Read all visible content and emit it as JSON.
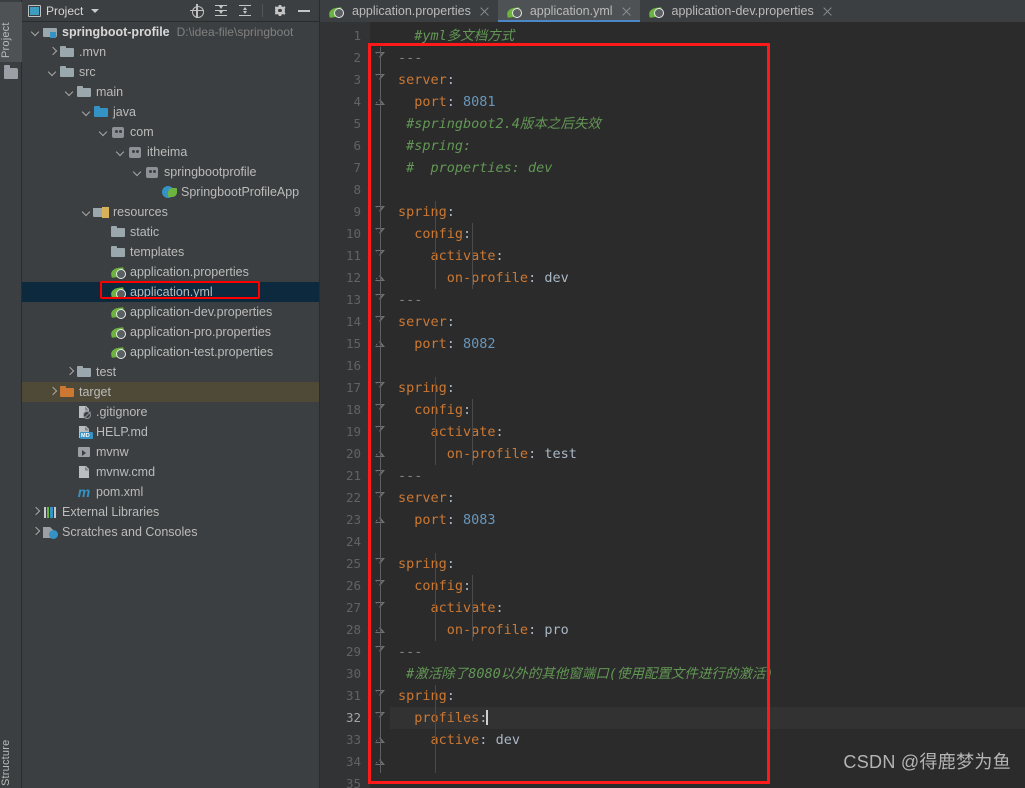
{
  "toolwindow_bars": {
    "left_top": "Project",
    "left_bottom": "Structure"
  },
  "panel": {
    "title": "Project",
    "title_icon": "project-window-icon",
    "actions": [
      {
        "name": "locate-icon",
        "label": "Select Opened File"
      },
      {
        "name": "expand-all-icon",
        "label": "Expand All"
      },
      {
        "name": "collapse-all-icon",
        "label": "Collapse All"
      },
      {
        "name": "gear-icon",
        "label": "Settings"
      },
      {
        "name": "minimize-icon",
        "label": "Hide"
      }
    ]
  },
  "tree": [
    {
      "label": "springboot-profile",
      "path": "D:\\idea-file\\springboot",
      "icon": "module-folder-icon",
      "arrow": "down",
      "depth": 0,
      "bold": true
    },
    {
      "label": ".mvn",
      "icon": "folder-icon",
      "arrow": "right",
      "depth": 1,
      "bold": false
    },
    {
      "label": "src",
      "icon": "folder-icon",
      "arrow": "down",
      "depth": 1,
      "bold": false
    },
    {
      "label": "main",
      "icon": "folder-icon",
      "arrow": "down",
      "depth": 2,
      "bold": false
    },
    {
      "label": "java",
      "icon": "source-folder-icon",
      "arrow": "down",
      "depth": 3,
      "bold": false
    },
    {
      "label": "com",
      "icon": "package-icon",
      "arrow": "down",
      "depth": 4,
      "bold": false
    },
    {
      "label": "itheima",
      "icon": "package-icon",
      "arrow": "down",
      "depth": 5,
      "bold": false
    },
    {
      "label": "springbootprofile",
      "icon": "package-icon",
      "arrow": "down",
      "depth": 6,
      "bold": false
    },
    {
      "label": "SpringbootProfileApp",
      "icon": "spring-application-class-icon",
      "arrow": "none",
      "depth": 7,
      "bold": false
    },
    {
      "label": "resources",
      "icon": "resources-folder-icon",
      "arrow": "down",
      "depth": 3,
      "bold": false
    },
    {
      "label": "static",
      "icon": "folder-icon",
      "arrow": "none",
      "depth": 4,
      "bold": false
    },
    {
      "label": "templates",
      "icon": "folder-icon",
      "arrow": "none",
      "depth": 4,
      "bold": false
    },
    {
      "label": "application.properties",
      "icon": "spring-config-icon",
      "arrow": "none",
      "depth": 4,
      "bold": false
    },
    {
      "label": "application.yml",
      "icon": "spring-config-icon",
      "arrow": "none",
      "depth": 4,
      "bold": false,
      "selected": "blue",
      "annotated": true
    },
    {
      "label": "application-dev.properties",
      "icon": "spring-config-icon",
      "arrow": "none",
      "depth": 4,
      "bold": false
    },
    {
      "label": "application-pro.properties",
      "icon": "spring-config-icon",
      "arrow": "none",
      "depth": 4,
      "bold": false
    },
    {
      "label": "application-test.properties",
      "icon": "spring-config-icon",
      "arrow": "none",
      "depth": 4,
      "bold": false
    },
    {
      "label": "test",
      "icon": "folder-icon",
      "arrow": "right",
      "depth": 2,
      "bold": false
    },
    {
      "label": "target",
      "icon": "target-folder-icon",
      "arrow": "right",
      "depth": 1,
      "bold": false,
      "selected": "brown"
    },
    {
      "label": ".gitignore",
      "icon": "gitignore-file-icon",
      "arrow": "none",
      "depth": 2,
      "bold": false
    },
    {
      "label": "HELP.md",
      "icon": "markdown-file-icon",
      "arrow": "none",
      "depth": 2,
      "bold": false
    },
    {
      "label": "mvnw",
      "icon": "shell-script-icon",
      "arrow": "none",
      "depth": 2,
      "bold": false
    },
    {
      "label": "mvnw.cmd",
      "icon": "text-file-icon",
      "arrow": "none",
      "depth": 2,
      "bold": false
    },
    {
      "label": "pom.xml",
      "icon": "maven-pom-icon",
      "arrow": "none",
      "depth": 2,
      "bold": false
    },
    {
      "label": "External Libraries",
      "icon": "external-libraries-icon",
      "arrow": "right",
      "depth": 0,
      "bold": false
    },
    {
      "label": "Scratches and Consoles",
      "icon": "scratches-icon",
      "arrow": "right",
      "depth": 0,
      "bold": false
    }
  ],
  "tabs": [
    {
      "label": "application.properties",
      "icon": "spring-config-icon",
      "active": false
    },
    {
      "label": "application.yml",
      "icon": "spring-config-icon",
      "active": true
    },
    {
      "label": "application-dev.properties",
      "icon": "spring-config-icon",
      "active": false
    }
  ],
  "editor": {
    "current_line": 32,
    "total_lines_shown": 35,
    "lines": [
      {
        "n": 1,
        "fold": "none",
        "tokens": [
          {
            "t": "  ",
            "c": "t-punc"
          },
          {
            "t": "#yml多文档方式",
            "c": "t-comment"
          }
        ]
      },
      {
        "n": 2,
        "fold": "tri",
        "tokens": [
          {
            "t": "---",
            "c": "t-sep"
          }
        ]
      },
      {
        "n": 3,
        "fold": "tri",
        "tokens": [
          {
            "t": "server",
            "c": "t-key"
          },
          {
            "t": ":",
            "c": "t-punc"
          }
        ]
      },
      {
        "n": 4,
        "fold": "end",
        "tokens": [
          {
            "t": "  ",
            "c": "t-punc"
          },
          {
            "t": "port",
            "c": "t-key"
          },
          {
            "t": ": ",
            "c": "t-punc"
          },
          {
            "t": "8081",
            "c": "t-num"
          }
        ]
      },
      {
        "n": 5,
        "fold": "none",
        "tokens": [
          {
            "t": " ",
            "c": "t-punc"
          },
          {
            "t": "#springboot2.4版本之后失效",
            "c": "t-comment"
          }
        ]
      },
      {
        "n": 6,
        "fold": "none",
        "tokens": [
          {
            "t": " ",
            "c": "t-punc"
          },
          {
            "t": "#spring:",
            "c": "t-comment"
          }
        ]
      },
      {
        "n": 7,
        "fold": "none",
        "tokens": [
          {
            "t": " ",
            "c": "t-punc"
          },
          {
            "t": "#  properties: dev",
            "c": "t-comment"
          }
        ]
      },
      {
        "n": 8,
        "fold": "none",
        "tokens": []
      },
      {
        "n": 9,
        "fold": "tri",
        "tokens": [
          {
            "t": "spring",
            "c": "t-key"
          },
          {
            "t": ":",
            "c": "t-punc"
          }
        ]
      },
      {
        "n": 10,
        "fold": "tri",
        "tokens": [
          {
            "t": "  ",
            "c": "t-punc"
          },
          {
            "t": "config",
            "c": "t-key"
          },
          {
            "t": ":",
            "c": "t-punc"
          }
        ]
      },
      {
        "n": 11,
        "fold": "tri",
        "tokens": [
          {
            "t": "    ",
            "c": "t-punc"
          },
          {
            "t": "activate",
            "c": "t-key"
          },
          {
            "t": ":",
            "c": "t-punc"
          }
        ]
      },
      {
        "n": 12,
        "fold": "end",
        "tokens": [
          {
            "t": "      ",
            "c": "t-punc"
          },
          {
            "t": "on-profile",
            "c": "t-key"
          },
          {
            "t": ": ",
            "c": "t-punc"
          },
          {
            "t": "dev",
            "c": "t-str"
          }
        ]
      },
      {
        "n": 13,
        "fold": "tri",
        "tokens": [
          {
            "t": "---",
            "c": "t-sep"
          }
        ]
      },
      {
        "n": 14,
        "fold": "tri",
        "tokens": [
          {
            "t": "server",
            "c": "t-key"
          },
          {
            "t": ":",
            "c": "t-punc"
          }
        ]
      },
      {
        "n": 15,
        "fold": "end",
        "tokens": [
          {
            "t": "  ",
            "c": "t-punc"
          },
          {
            "t": "port",
            "c": "t-key"
          },
          {
            "t": ": ",
            "c": "t-punc"
          },
          {
            "t": "8082",
            "c": "t-num"
          }
        ]
      },
      {
        "n": 16,
        "fold": "none",
        "tokens": []
      },
      {
        "n": 17,
        "fold": "tri",
        "tokens": [
          {
            "t": "spring",
            "c": "t-key"
          },
          {
            "t": ":",
            "c": "t-punc"
          }
        ]
      },
      {
        "n": 18,
        "fold": "tri",
        "tokens": [
          {
            "t": "  ",
            "c": "t-punc"
          },
          {
            "t": "config",
            "c": "t-key"
          },
          {
            "t": ":",
            "c": "t-punc"
          }
        ]
      },
      {
        "n": 19,
        "fold": "tri",
        "tokens": [
          {
            "t": "    ",
            "c": "t-punc"
          },
          {
            "t": "activate",
            "c": "t-key"
          },
          {
            "t": ":",
            "c": "t-punc"
          }
        ]
      },
      {
        "n": 20,
        "fold": "end",
        "tokens": [
          {
            "t": "      ",
            "c": "t-punc"
          },
          {
            "t": "on-profile",
            "c": "t-key"
          },
          {
            "t": ": ",
            "c": "t-punc"
          },
          {
            "t": "test",
            "c": "t-str"
          }
        ]
      },
      {
        "n": 21,
        "fold": "tri",
        "tokens": [
          {
            "t": "---",
            "c": "t-sep"
          }
        ]
      },
      {
        "n": 22,
        "fold": "tri",
        "tokens": [
          {
            "t": "server",
            "c": "t-key"
          },
          {
            "t": ":",
            "c": "t-punc"
          }
        ]
      },
      {
        "n": 23,
        "fold": "end",
        "tokens": [
          {
            "t": "  ",
            "c": "t-punc"
          },
          {
            "t": "port",
            "c": "t-key"
          },
          {
            "t": ": ",
            "c": "t-punc"
          },
          {
            "t": "8083",
            "c": "t-num"
          }
        ]
      },
      {
        "n": 24,
        "fold": "none",
        "tokens": []
      },
      {
        "n": 25,
        "fold": "tri",
        "tokens": [
          {
            "t": "spring",
            "c": "t-key"
          },
          {
            "t": ":",
            "c": "t-punc"
          }
        ]
      },
      {
        "n": 26,
        "fold": "tri",
        "tokens": [
          {
            "t": "  ",
            "c": "t-punc"
          },
          {
            "t": "config",
            "c": "t-key"
          },
          {
            "t": ":",
            "c": "t-punc"
          }
        ]
      },
      {
        "n": 27,
        "fold": "tri",
        "tokens": [
          {
            "t": "    ",
            "c": "t-punc"
          },
          {
            "t": "activate",
            "c": "t-key"
          },
          {
            "t": ":",
            "c": "t-punc"
          }
        ]
      },
      {
        "n": 28,
        "fold": "end",
        "tokens": [
          {
            "t": "      ",
            "c": "t-punc"
          },
          {
            "t": "on-profile",
            "c": "t-key"
          },
          {
            "t": ": ",
            "c": "t-punc"
          },
          {
            "t": "pro",
            "c": "t-str"
          }
        ]
      },
      {
        "n": 29,
        "fold": "tri",
        "tokens": [
          {
            "t": "---",
            "c": "t-sep"
          }
        ]
      },
      {
        "n": 30,
        "fold": "none",
        "tokens": [
          {
            "t": " ",
            "c": "t-punc"
          },
          {
            "t": "#激活除了8080以外的其他窗端口(使用配置文件进行的激活)",
            "c": "t-comment"
          }
        ]
      },
      {
        "n": 31,
        "fold": "tri",
        "tokens": [
          {
            "t": "spring",
            "c": "t-key"
          },
          {
            "t": ":",
            "c": "t-punc"
          }
        ]
      },
      {
        "n": 32,
        "fold": "tri",
        "current": true,
        "caret_after": true,
        "tokens": [
          {
            "t": "  ",
            "c": "t-punc"
          },
          {
            "t": "profiles",
            "c": "t-key"
          },
          {
            "t": ":",
            "c": "t-punc"
          }
        ]
      },
      {
        "n": 33,
        "fold": "end",
        "tokens": [
          {
            "t": "    ",
            "c": "t-punc"
          },
          {
            "t": "active",
            "c": "t-key"
          },
          {
            "t": ": ",
            "c": "t-punc"
          },
          {
            "t": "dev",
            "c": "t-str"
          }
        ]
      },
      {
        "n": 34,
        "fold": "end",
        "tokens": []
      },
      {
        "n": 35,
        "fold": "none",
        "tokens": []
      }
    ]
  },
  "annotations": {
    "yml_box_color": "#ff0000",
    "code_box_color": "#ff1a1a"
  },
  "watermark": "CSDN @得鹿梦为鱼",
  "colors": {
    "editor_bg": "#2b2b2b",
    "panel_bg": "#3c3f41",
    "gutter_bg": "#313335",
    "selection_blue": "#0d293e",
    "selection_brown": "#4e4a37",
    "keyword": "#cc7832",
    "number": "#6897bb",
    "comment": "#629755",
    "text": "#a9b7c6",
    "tab_active_underline": "#4a88c7"
  }
}
